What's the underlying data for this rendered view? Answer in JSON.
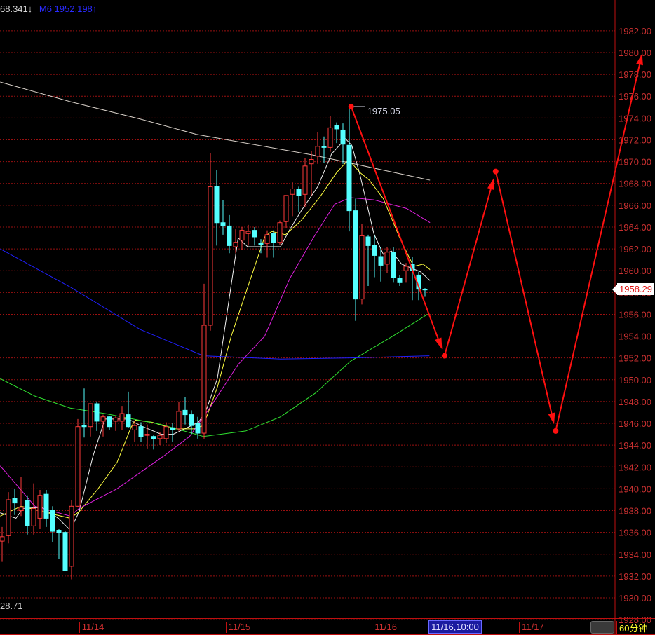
{
  "legend": {
    "ma_value": "68.341↓",
    "m6_label": "M6 1952.198↑"
  },
  "low_label": "28.71",
  "last_price": "1958.29",
  "xaxis": {
    "cursor_label": "11/16,10:00",
    "period": "60分钟"
  },
  "colors": {
    "up": "#ff3a3a",
    "down": "#54ffff",
    "grid": "#9a1010",
    "axis_text": "#c83030",
    "annotation": "#ff1010"
  },
  "chart_data": {
    "type": "candlestick",
    "title": "",
    "ylim": [
      1927,
      1984
    ],
    "ytick_step": 2,
    "yticks": [
      "1930.00",
      "1932.00",
      "1934.00",
      "1936.00",
      "1938.00",
      "1940.00",
      "1942.00",
      "1944.00",
      "1946.00",
      "1948.00",
      "1950.00",
      "1952.00",
      "1954.00",
      "1956.00",
      "1958.00",
      "1960.00",
      "1962.00",
      "1964.00",
      "1966.00",
      "1968.00",
      "1970.00",
      "1972.00",
      "1974.00",
      "1976.00",
      "1978.00",
      "1980.00",
      "1982.00",
      "1928.00"
    ],
    "ytick_values": [
      1930,
      1932,
      1934,
      1936,
      1938,
      1940,
      1942,
      1944,
      1946,
      1948,
      1950,
      1952,
      1954,
      1956,
      1958,
      1960,
      1962,
      1964,
      1966,
      1968,
      1970,
      1972,
      1974,
      1976,
      1978,
      1980,
      1982,
      1928
    ],
    "xticks": [
      {
        "label": "11/14",
        "index": 12.2
      },
      {
        "label": "11/15",
        "index": 35.4
      },
      {
        "label": "11/16",
        "index": 58.6
      },
      {
        "label": "11/17",
        "index": 81.9
      }
    ],
    "cursor_index": 67.6,
    "ohlc": [
      [
        1935.2,
        1936.5,
        1933.3,
        1935.6
      ],
      [
        1935.7,
        1939.7,
        1935.0,
        1939.0
      ],
      [
        1939.1,
        1940.0,
        1937.6,
        1938.7
      ],
      [
        1938.0,
        1941.1,
        1937.5,
        1938.3
      ],
      [
        1938.9,
        1939.4,
        1935.8,
        1936.6
      ],
      [
        1936.6,
        1940.5,
        1935.8,
        1938.2
      ],
      [
        1937.3,
        1939.9,
        1936.3,
        1939.4
      ],
      [
        1939.5,
        1939.9,
        1936.5,
        1937.3
      ],
      [
        1938.0,
        1938.4,
        1935.1,
        1936.1
      ],
      [
        1936.2,
        1936.3,
        1933.6,
        1936.0
      ],
      [
        1936.0,
        1936.1,
        1932.5,
        1932.5
      ],
      [
        1932.9,
        1939.0,
        1931.7,
        1938.4
      ],
      [
        1938.4,
        1946.4,
        1938.3,
        1945.7
      ],
      [
        1945.8,
        1949.2,
        1944.7,
        1945.7
      ],
      [
        1945.7,
        1947.8,
        1944.8,
        1947.8
      ],
      [
        1947.8,
        1948.0,
        1945.3,
        1946.2
      ],
      [
        1946.2,
        1946.8,
        1944.8,
        1946.6
      ],
      [
        1946.6,
        1946.7,
        1945.4,
        1945.7
      ],
      [
        1946.2,
        1946.7,
        1945.3,
        1946.5
      ],
      [
        1946.2,
        1947.6,
        1945.4,
        1946.9
      ],
      [
        1946.8,
        1948.9,
        1945.6,
        1945.7
      ],
      [
        1945.4,
        1946.2,
        1944.3,
        1945.8
      ],
      [
        1945.7,
        1946.1,
        1944.3,
        1944.8
      ],
      [
        1944.9,
        1945.9,
        1943.7,
        1945.0
      ],
      [
        1944.8,
        1944.9,
        1943.6,
        1944.6
      ],
      [
        1944.6,
        1945.2,
        1944.0,
        1944.9
      ],
      [
        1944.6,
        1946.1,
        1944.2,
        1945.7
      ],
      [
        1945.6,
        1946.0,
        1944.3,
        1945.4
      ],
      [
        1945.5,
        1948.0,
        1945.3,
        1947.1
      ],
      [
        1947.2,
        1948.4,
        1945.9,
        1946.8
      ],
      [
        1946.8,
        1947.2,
        1945.0,
        1945.8
      ],
      [
        1946.0,
        1946.6,
        1944.6,
        1945.1
      ],
      [
        1945.1,
        1958.8,
        1944.6,
        1955.0
      ],
      [
        1955.0,
        1970.8,
        1954.5,
        1967.7
      ],
      [
        1967.7,
        1969.2,
        1962.3,
        1964.4
      ],
      [
        1964.4,
        1966.5,
        1963.3,
        1964.1
      ],
      [
        1964.1,
        1965.1,
        1961.6,
        1962.3
      ],
      [
        1962.2,
        1963.8,
        1961.6,
        1962.6
      ],
      [
        1962.8,
        1964.0,
        1961.9,
        1963.7
      ],
      [
        1963.4,
        1964.2,
        1962.3,
        1963.6
      ],
      [
        1963.7,
        1964.0,
        1962.3,
        1963.1
      ],
      [
        1962.5,
        1962.9,
        1961.6,
        1962.4
      ],
      [
        1962.5,
        1963.7,
        1961.2,
        1963.3
      ],
      [
        1963.4,
        1963.7,
        1961.2,
        1962.6
      ],
      [
        1962.6,
        1964.6,
        1962.4,
        1964.4
      ],
      [
        1964.5,
        1966.9,
        1963.9,
        1966.9
      ],
      [
        1967.0,
        1968.1,
        1965.0,
        1967.5
      ],
      [
        1967.5,
        1967.7,
        1965.4,
        1966.9
      ],
      [
        1967.0,
        1970.3,
        1965.8,
        1969.6
      ],
      [
        1969.8,
        1971.0,
        1966.9,
        1970.2
      ],
      [
        1970.5,
        1972.7,
        1969.8,
        1971.4
      ],
      [
        1971.4,
        1972.3,
        1969.9,
        1971.3
      ],
      [
        1971.3,
        1974.2,
        1970.9,
        1973.1
      ],
      [
        1973.3,
        1973.6,
        1971.7,
        1973.0
      ],
      [
        1972.9,
        1973.5,
        1969.8,
        1971.6
      ],
      [
        1971.5,
        1975.05,
        1963.6,
        1965.5
      ],
      [
        1965.5,
        1966.6,
        1955.4,
        1957.4
      ],
      [
        1957.4,
        1964.3,
        1956.9,
        1963.2
      ],
      [
        1963.1,
        1963.3,
        1958.6,
        1962.3
      ],
      [
        1962.3,
        1963.2,
        1959.4,
        1961.4
      ],
      [
        1961.3,
        1962.2,
        1959.0,
        1960.5
      ],
      [
        1960.6,
        1962.2,
        1959.8,
        1961.7
      ],
      [
        1961.7,
        1962.2,
        1958.9,
        1959.4
      ],
      [
        1959.3,
        1959.6,
        1958.6,
        1958.9
      ],
      [
        1960.0,
        1960.7,
        1958.9,
        1960.4
      ],
      [
        1960.6,
        1961.3,
        1957.3,
        1960.0
      ],
      [
        1959.6,
        1959.9,
        1957.3,
        1958.3
      ],
      [
        1958.3,
        1958.4,
        1957.6,
        1958.29
      ]
    ],
    "moving_averages": [
      {
        "name": "ma-white",
        "color": "#f0f0f0",
        "points": [
          [
            -0.3,
            1937.8
          ],
          [
            2.2,
            1937.3
          ],
          [
            3.3,
            1938.2
          ],
          [
            6.3,
            1938.3
          ],
          [
            8.9,
            1937.3
          ],
          [
            10.8,
            1936.2
          ],
          [
            12.2,
            1937.9
          ],
          [
            14.4,
            1943.0
          ],
          [
            16.3,
            1946.4
          ],
          [
            20,
            1946.4
          ],
          [
            21.9,
            1945.8
          ],
          [
            25.2,
            1945.0
          ],
          [
            27.1,
            1945.0
          ],
          [
            29.3,
            1945.6
          ],
          [
            31.1,
            1946.1
          ],
          [
            32.2,
            1947.0
          ],
          [
            34.1,
            1950.1
          ],
          [
            37.4,
            1963.0
          ],
          [
            38.9,
            1962.2
          ],
          [
            41.9,
            1962.2
          ],
          [
            44.1,
            1962.2
          ],
          [
            45.6,
            1963.8
          ],
          [
            47.4,
            1965.5
          ],
          [
            50,
            1967.7
          ],
          [
            52.2,
            1970.7
          ],
          [
            54.4,
            1972.1
          ],
          [
            55.4,
            1971.5
          ],
          [
            56.7,
            1968.8
          ],
          [
            58.9,
            1963.4
          ],
          [
            60.4,
            1961.5
          ],
          [
            61.7,
            1961.8
          ],
          [
            63.3,
            1960.6
          ],
          [
            66.3,
            1959.9
          ],
          [
            67.8,
            1959.1
          ]
        ]
      },
      {
        "name": "ma-yellow",
        "color": "#ffff40",
        "points": [
          [
            -0.3,
            1937.5
          ],
          [
            3,
            1938.4
          ],
          [
            5.2,
            1938.1
          ],
          [
            8.6,
            1937.6
          ],
          [
            10.8,
            1937.3
          ],
          [
            12.2,
            1937.9
          ],
          [
            15.2,
            1940.0
          ],
          [
            18.2,
            1942.4
          ],
          [
            20.4,
            1945.6
          ],
          [
            21.1,
            1946.3
          ],
          [
            23.8,
            1946.1
          ],
          [
            27.1,
            1945.5
          ],
          [
            30.4,
            1945.5
          ],
          [
            31.9,
            1945.8
          ],
          [
            34.1,
            1949.3
          ],
          [
            36.3,
            1954.0
          ],
          [
            41.6,
            1963.1
          ],
          [
            42.7,
            1963.6
          ],
          [
            44.9,
            1963.3
          ],
          [
            47.4,
            1964.6
          ],
          [
            50.4,
            1966.8
          ],
          [
            53,
            1969.0
          ],
          [
            54.9,
            1970.2
          ],
          [
            56.7,
            1969.0
          ],
          [
            58.2,
            1968.3
          ],
          [
            60.4,
            1966.6
          ],
          [
            63,
            1963.0
          ],
          [
            65.2,
            1960.4
          ],
          [
            66.7,
            1960.6
          ],
          [
            67.8,
            1960.1
          ]
        ]
      },
      {
        "name": "ma-magenta",
        "color": "#e020e0",
        "points": [
          [
            -0.3,
            1942.1
          ],
          [
            5.2,
            1938.4
          ],
          [
            10.8,
            1937.5
          ],
          [
            12.2,
            1938.2
          ],
          [
            18.2,
            1940.0
          ],
          [
            25.6,
            1943.0
          ],
          [
            29.7,
            1944.8
          ],
          [
            33,
            1947.5
          ],
          [
            37.4,
            1951.4
          ],
          [
            41.6,
            1954.0
          ],
          [
            45.6,
            1959.3
          ],
          [
            49.3,
            1963.0
          ],
          [
            52.7,
            1966.1
          ],
          [
            55.2,
            1966.7
          ],
          [
            58.9,
            1966.5
          ],
          [
            64.1,
            1965.7
          ],
          [
            67.8,
            1964.4
          ]
        ]
      },
      {
        "name": "ma-green",
        "color": "#30e030",
        "points": [
          [
            -0.3,
            1950.1
          ],
          [
            5.2,
            1948.5
          ],
          [
            10.8,
            1947.4
          ],
          [
            16.3,
            1946.9
          ],
          [
            25.2,
            1945.9
          ],
          [
            31.9,
            1944.8
          ],
          [
            38.6,
            1945.3
          ],
          [
            44.1,
            1946.6
          ],
          [
            49.7,
            1948.8
          ],
          [
            55.2,
            1951.7
          ],
          [
            61.9,
            1954.0
          ],
          [
            67.4,
            1956.0
          ]
        ]
      },
      {
        "name": "ma-blue",
        "color": "#2020ff",
        "points": [
          [
            -0.3,
            1962.0
          ],
          [
            10.8,
            1958.5
          ],
          [
            21.9,
            1954.6
          ],
          [
            31.9,
            1952.2
          ],
          [
            44.1,
            1951.9
          ],
          [
            55.2,
            1952.0
          ],
          [
            67.7,
            1952.2
          ]
        ]
      },
      {
        "name": "ma-gray",
        "color": "#d8d0c8",
        "points": [
          [
            -0.3,
            1977.3
          ],
          [
            10.8,
            1975.5
          ],
          [
            21.9,
            1973.9
          ],
          [
            30.8,
            1972.5
          ],
          [
            49.3,
            1970.6
          ],
          [
            67.8,
            1968.3
          ]
        ]
      }
    ],
    "peak_annotation": {
      "index": 55.3,
      "price": 1975.05,
      "label": "1975.05"
    },
    "forecast_path": [
      [
        55.3,
        1975.05
      ],
      [
        70.1,
        1952.2
      ],
      [
        78.2,
        1969.1
      ],
      [
        87.7,
        1945.3
      ],
      [
        101.4,
        1979.9
      ]
    ]
  }
}
